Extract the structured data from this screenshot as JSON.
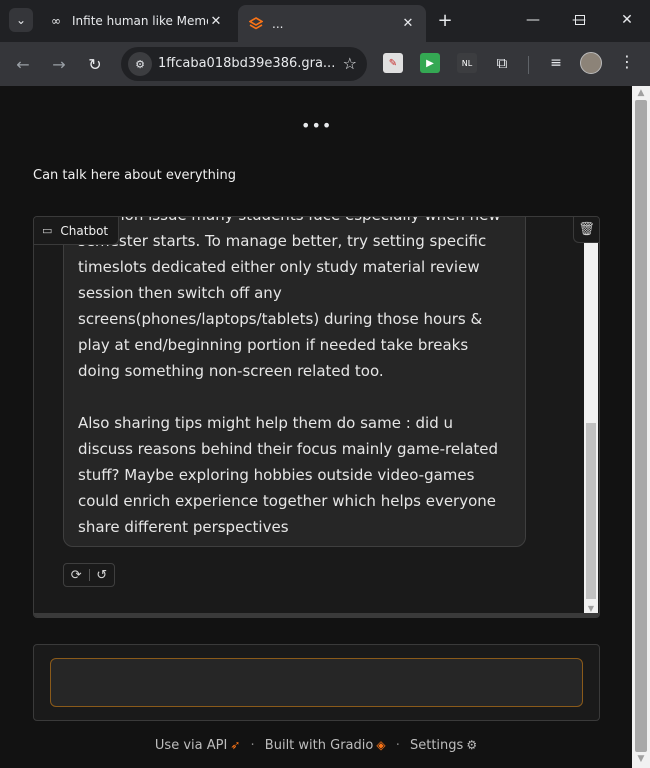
{
  "browser": {
    "tabs": [
      {
        "title": "Infite human like Memo",
        "favicon": "infinity-icon",
        "active": false
      },
      {
        "title": "...",
        "favicon": "gradio-logo-icon",
        "active": true
      }
    ],
    "url": "1ffcaba018bd39e386.gra..."
  },
  "page": {
    "description": "Can talk here about everything",
    "chatbot": {
      "label": "Chatbot",
      "message_paragraphs": [
        "common issue many students face especially when new semester starts. To manage better, try setting specific timeslots dedicated either only study material review session then switch off any screens(phones/laptops/tablets) during those hours & play at end/beginning portion if needed take breaks doing something non-screen related too.",
        "Also sharing tips might help them do same : did u discuss reasons behind their focus mainly game-related stuff? Maybe exploring hobbies outside video-games could enrich experience together which helps everyone share different perspectives"
      ]
    },
    "input": {
      "placeholder": "",
      "value": ""
    },
    "footer": {
      "api": "Use via API",
      "built": "Built with Gradio",
      "settings": "Settings"
    }
  },
  "colors": {
    "accent": "#f97316",
    "background": "#121212",
    "panel": "#1a1a1a"
  }
}
